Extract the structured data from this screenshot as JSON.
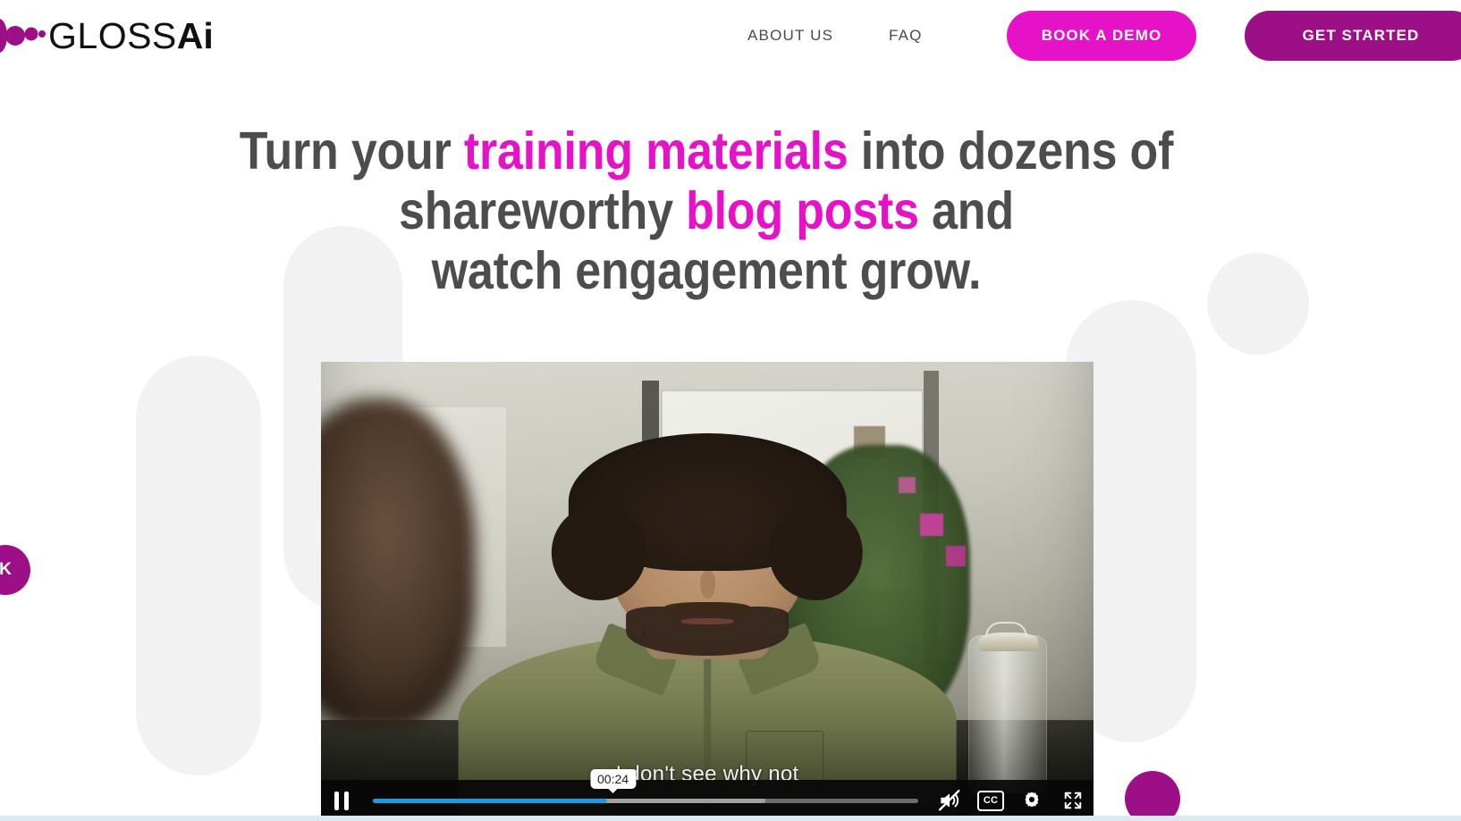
{
  "brand": {
    "logo_text_primary": "GLOSS",
    "logo_text_accent": "Ai",
    "logo_mark": "gloss-dots-icon",
    "accent_pink": "#e612c8",
    "accent_purple": "#9c0f86",
    "text_gray": "#4d4d4d"
  },
  "header": {
    "nav": [
      {
        "label": "ABOUT US",
        "name": "nav-link-about-us"
      },
      {
        "label": "FAQ",
        "name": "nav-link-faq"
      }
    ],
    "buttons": {
      "demo_label": "BOOK A DEMO",
      "start_label": "GET STARTED"
    }
  },
  "hero": {
    "headline": {
      "line1_a": "Turn your ",
      "line1_highlight": "training materials",
      "line1_b": " into dozens of",
      "line2_a": "shareworthy ",
      "line2_highlight": "blog posts",
      "line2_b": " and",
      "line3": "watch engagement grow."
    }
  },
  "video": {
    "state": "playing",
    "subtitle_text": "I don't see why not",
    "hover_time": "00:24",
    "progress_percent": 43,
    "buffered_percent": 72,
    "controls": {
      "pause": {
        "label": "Pause",
        "icon": "pause-icon"
      },
      "mute": {
        "label": "Unmute",
        "icon": "volume-muted-icon",
        "muted": true
      },
      "captions": {
        "label": "CC",
        "icon": "closed-captions-icon",
        "enabled": true
      },
      "settings": {
        "label": "Settings",
        "icon": "gear-icon"
      },
      "fullscreen": {
        "label": "Fullscreen",
        "icon": "fullscreen-icon"
      }
    },
    "progress_color": "#1e9ae0"
  },
  "widgets": {
    "side_tab_label": "K",
    "corner_bubble": "chat-bubble"
  }
}
